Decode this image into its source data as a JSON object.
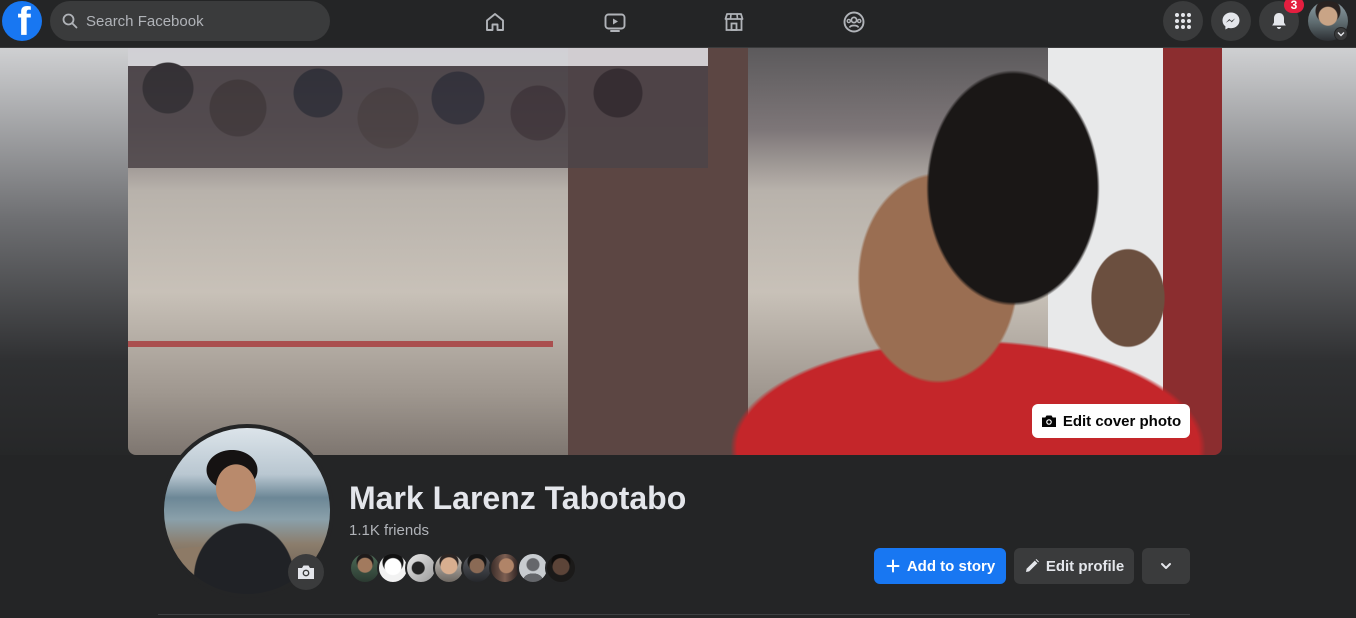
{
  "topbar": {
    "logo_letter": "f",
    "search": {
      "placeholder": "Search Facebook"
    },
    "nav_icons": [
      "home-icon",
      "watch-icon",
      "marketplace-icon",
      "groups-icon"
    ],
    "right_icons": [
      "menu-grid-icon",
      "messenger-icon",
      "notifications-icon"
    ],
    "notifications_count": "3"
  },
  "cover": {
    "edit_label": "Edit cover photo"
  },
  "profile": {
    "name": "Mark Larenz Tabotabo",
    "friends": "1.1K friends",
    "friend_avatar_count": 8
  },
  "actions": {
    "add_story": "Add to story",
    "edit_profile": "Edit profile",
    "more_icon": "chevron-down-icon"
  },
  "colors": {
    "accent": "#1877f2",
    "background": "#18191a",
    "surface": "#242526",
    "badge": "#e41e3f"
  }
}
